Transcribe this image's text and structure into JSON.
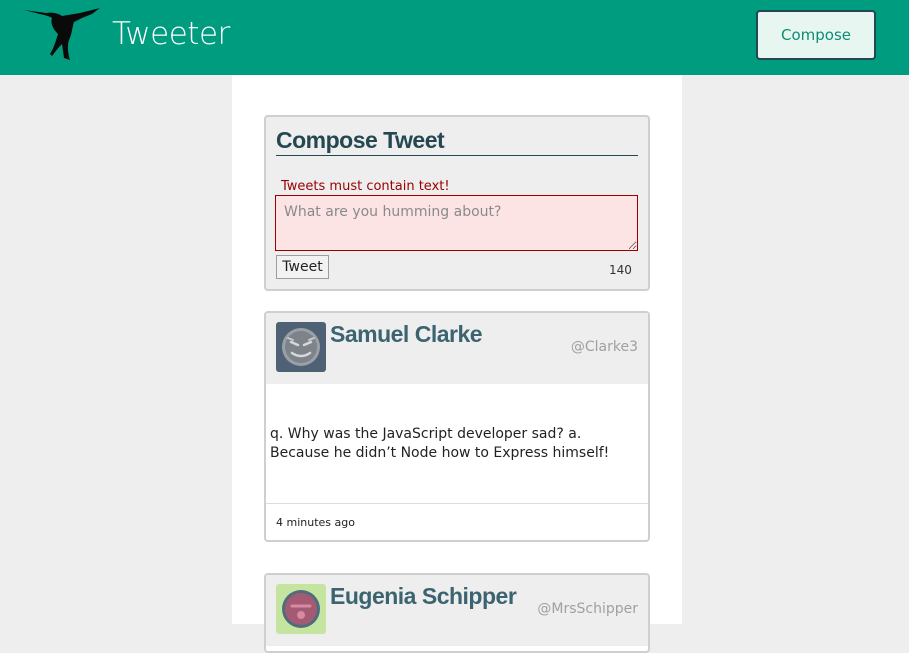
{
  "navbar": {
    "brand": "Tweeter",
    "compose_label": "Compose",
    "logo_icon": "hummingbird-icon",
    "background": "#009c80"
  },
  "compose": {
    "title": "Compose Tweet",
    "error": "Tweets must contain text!",
    "placeholder": "What are you humming about?",
    "submit_label": "Tweet",
    "counter": "140"
  },
  "tweets": [
    {
      "name": "Samuel Clarke",
      "handle": "@Clarke3",
      "text": "q. Why was the JavaScript developer sad? a. Because he didn’t Node how to Express himself!",
      "time": "4 minutes ago",
      "avatar_icon": "robot-avatar-icon"
    },
    {
      "name": "Eugenia Schipper",
      "handle": "@MrsSchipper",
      "avatar_icon": "robot-avatar-icon"
    }
  ]
}
